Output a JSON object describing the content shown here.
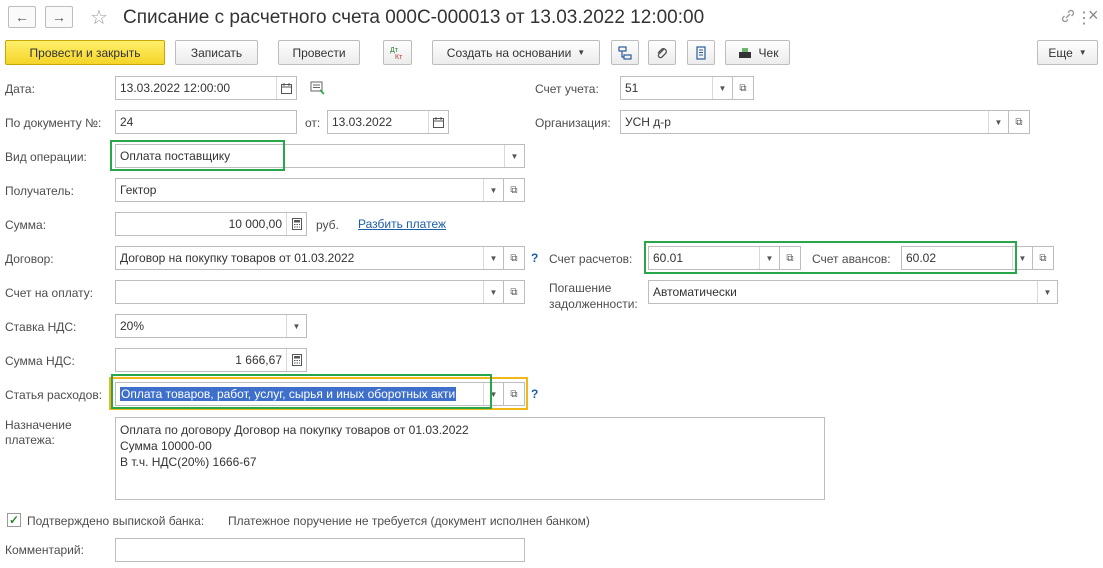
{
  "window": {
    "title": "Списание с расчетного счета 000С-000013 от 13.03.2022 12:00:00",
    "back_icon": "←",
    "forward_icon": "→",
    "star_icon": "☆",
    "link_icon": "🔗",
    "more_icon": "⋮",
    "close_icon": "×"
  },
  "toolbar": {
    "post_close_label": "Провести и закрыть",
    "write_label": "Записать",
    "post_label": "Провести",
    "dtkt_label": "Дт Кт",
    "create_based_label": "Создать на основании",
    "check_label": "Чек",
    "more_label": "Еще"
  },
  "form": {
    "date_label": "Дата:",
    "date_value": "13.03.2022 12:00:00",
    "doc_num_label": "По документу №:",
    "doc_num_value": "24",
    "from_label": "от:",
    "from_value": "13.03.2022",
    "operation_label": "Вид операции:",
    "operation_value": "Оплата поставщику",
    "recipient_label": "Получатель:",
    "recipient_value": "Гектор",
    "sum_label": "Сумма:",
    "sum_value": "10 000,00",
    "currency": "руб.",
    "split_link": "Разбить платеж",
    "contract_label": "Договор:",
    "contract_value": "Договор на покупку товаров от 01.03.2022",
    "invoice_label": "Счет на оплату:",
    "invoice_value": "",
    "vat_rate_label": "Ставка НДС:",
    "vat_rate_value": "20%",
    "vat_sum_label": "Сумма НДС:",
    "vat_sum_value": "1 666,67",
    "expense_label": "Статья расходов:",
    "expense_value": "Оплата товаров, работ, услуг, сырья и иных оборотных акти",
    "purpose_label_1": "Назначение",
    "purpose_label_2": "платежа:",
    "purpose_value": "Оплата по договору Договор на покупку товаров от 01.03.2022\nСумма 10000-00\nВ т.ч. НДС(20%) 1666-67",
    "account_label": "Счет учета:",
    "account_value": "51",
    "org_label": "Организация:",
    "org_value": "УСН д-р",
    "settle_account_label": "Счет расчетов:",
    "settle_account_value": "60.01",
    "advance_account_label": "Счет авансов:",
    "advance_account_value": "60.02",
    "repayment_label_1": "Погашение",
    "repayment_label_2": "задолженности:",
    "repayment_value": "Автоматически",
    "confirmed_label": "Подтверждено выпиской банка:",
    "confirmed_checked": true,
    "payment_order_text": "Платежное поручение не требуется (документ исполнен банком)",
    "comment_label": "Комментарий:",
    "comment_value": "",
    "question_mark": "?"
  },
  "colors": {
    "highlight_green": "#2aa64a",
    "highlight_yellow": "#f1b714",
    "primary_button": "#f4d428",
    "link": "#1b5ea8",
    "selection": "#3d6fcb"
  }
}
